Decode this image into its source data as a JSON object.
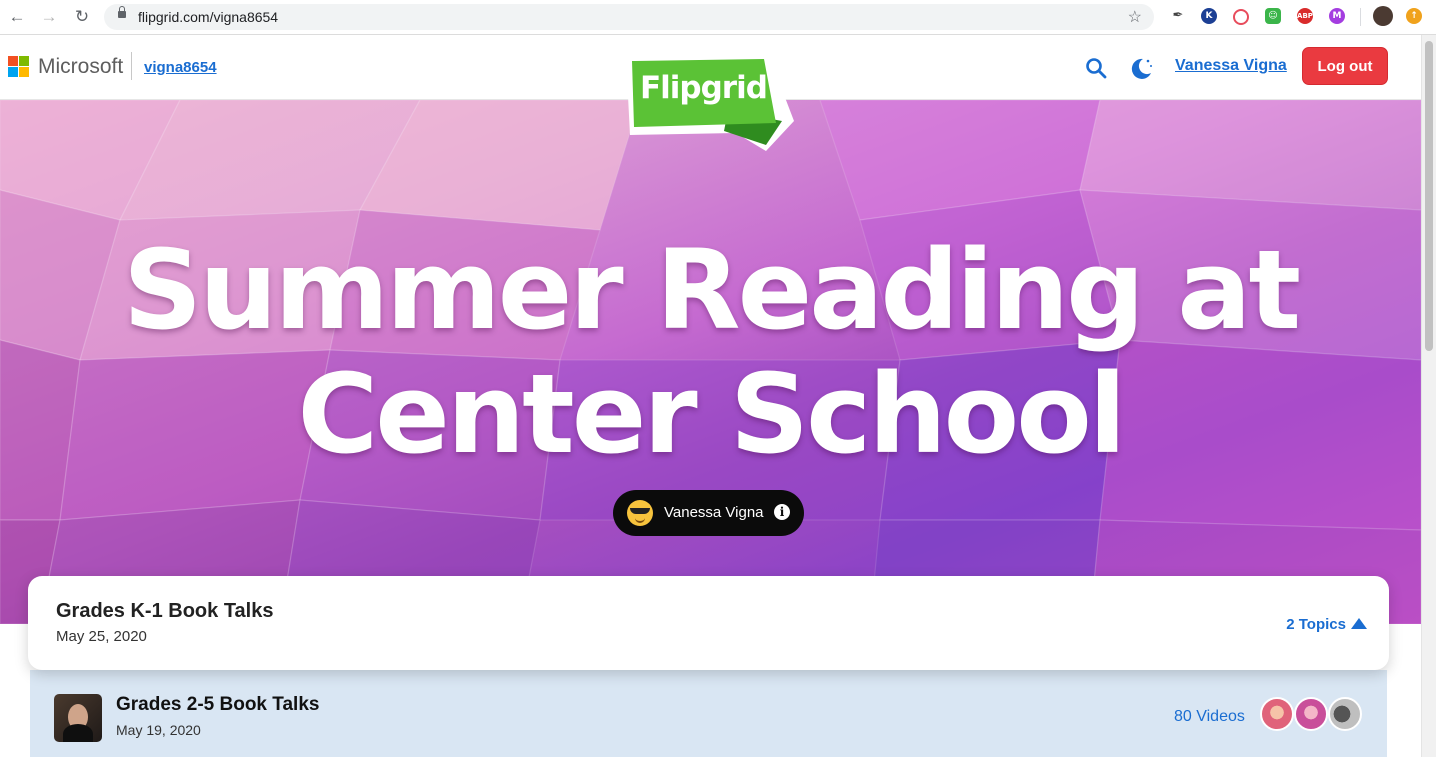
{
  "browser": {
    "url": "flipgrid.com/vigna8654"
  },
  "header": {
    "brand": "Microsoft",
    "username": "vigna8654",
    "logo_text": "Flipgrid",
    "user_name": "Vanessa Vigna",
    "logout_label": "Log out"
  },
  "hero": {
    "title": "Summer Reading at Center School",
    "owner_name": "Vanessa Vigna"
  },
  "group": {
    "title": "Grades K-1 Book Talks",
    "date": "May 25, 2020",
    "topics_label": "2 Topics"
  },
  "topic": {
    "title": "Grades 2-5 Book Talks",
    "date": "May 19, 2020",
    "videos_label": "80 Videos"
  },
  "colors": {
    "accent": "#1a6dd1",
    "logout": "#ea3a40",
    "flipgrid_green": "#5bc236"
  }
}
